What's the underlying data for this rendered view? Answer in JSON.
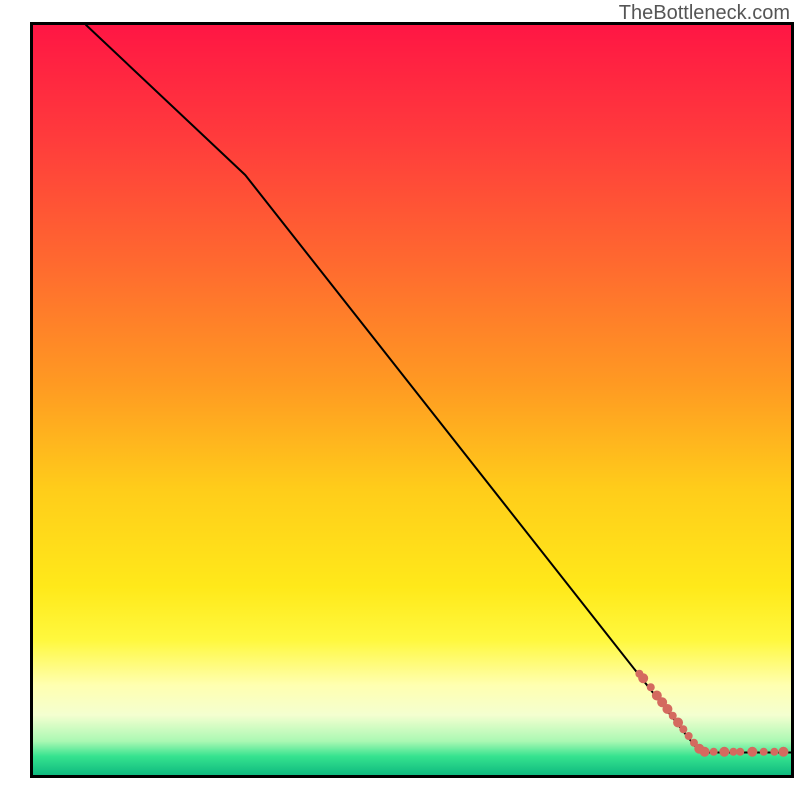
{
  "attribution": "TheBottleneck.com",
  "chart_data": {
    "type": "line",
    "title": "",
    "xlabel": "",
    "ylabel": "",
    "xlim": [
      0,
      100
    ],
    "ylim": [
      0,
      100
    ],
    "series": [
      {
        "name": "curve",
        "x": [
          7,
          28,
          88,
          100
        ],
        "values": [
          100,
          80,
          3,
          3
        ],
        "stroke": "#000000",
        "width": 2
      }
    ],
    "markers": {
      "name": "cluster",
      "color": "#d46a5f",
      "points": [
        {
          "x": 80.0,
          "y": 13.5,
          "r": 4
        },
        {
          "x": 80.5,
          "y": 12.9,
          "r": 5
        },
        {
          "x": 81.5,
          "y": 11.7,
          "r": 4
        },
        {
          "x": 82.3,
          "y": 10.6,
          "r": 5
        },
        {
          "x": 83.0,
          "y": 9.7,
          "r": 5
        },
        {
          "x": 83.7,
          "y": 8.8,
          "r": 5
        },
        {
          "x": 84.4,
          "y": 7.9,
          "r": 4
        },
        {
          "x": 85.1,
          "y": 7.0,
          "r": 5
        },
        {
          "x": 85.8,
          "y": 6.1,
          "r": 4
        },
        {
          "x": 86.5,
          "y": 5.2,
          "r": 4
        },
        {
          "x": 87.2,
          "y": 4.3,
          "r": 4
        },
        {
          "x": 87.9,
          "y": 3.5,
          "r": 5
        },
        {
          "x": 88.6,
          "y": 3.1,
          "r": 5
        },
        {
          "x": 89.8,
          "y": 3.1,
          "r": 4
        },
        {
          "x": 91.2,
          "y": 3.1,
          "r": 5
        },
        {
          "x": 92.4,
          "y": 3.1,
          "r": 4
        },
        {
          "x": 93.3,
          "y": 3.1,
          "r": 4
        },
        {
          "x": 94.9,
          "y": 3.1,
          "r": 5
        },
        {
          "x": 96.4,
          "y": 3.1,
          "r": 4
        },
        {
          "x": 97.8,
          "y": 3.1,
          "r": 4
        },
        {
          "x": 99.0,
          "y": 3.1,
          "r": 5
        }
      ]
    },
    "background_gradient": {
      "stops": [
        {
          "offset": 0.0,
          "color": "#ff1644"
        },
        {
          "offset": 0.15,
          "color": "#ff3b3c"
        },
        {
          "offset": 0.32,
          "color": "#ff6a2f"
        },
        {
          "offset": 0.48,
          "color": "#ff9a22"
        },
        {
          "offset": 0.62,
          "color": "#ffcd1a"
        },
        {
          "offset": 0.75,
          "color": "#ffe91a"
        },
        {
          "offset": 0.82,
          "color": "#fff83e"
        },
        {
          "offset": 0.88,
          "color": "#ffffb0"
        },
        {
          "offset": 0.92,
          "color": "#f4ffd0"
        },
        {
          "offset": 0.955,
          "color": "#aaf8b3"
        },
        {
          "offset": 0.975,
          "color": "#36e38f"
        },
        {
          "offset": 1.0,
          "color": "#0fba7f"
        }
      ]
    }
  }
}
